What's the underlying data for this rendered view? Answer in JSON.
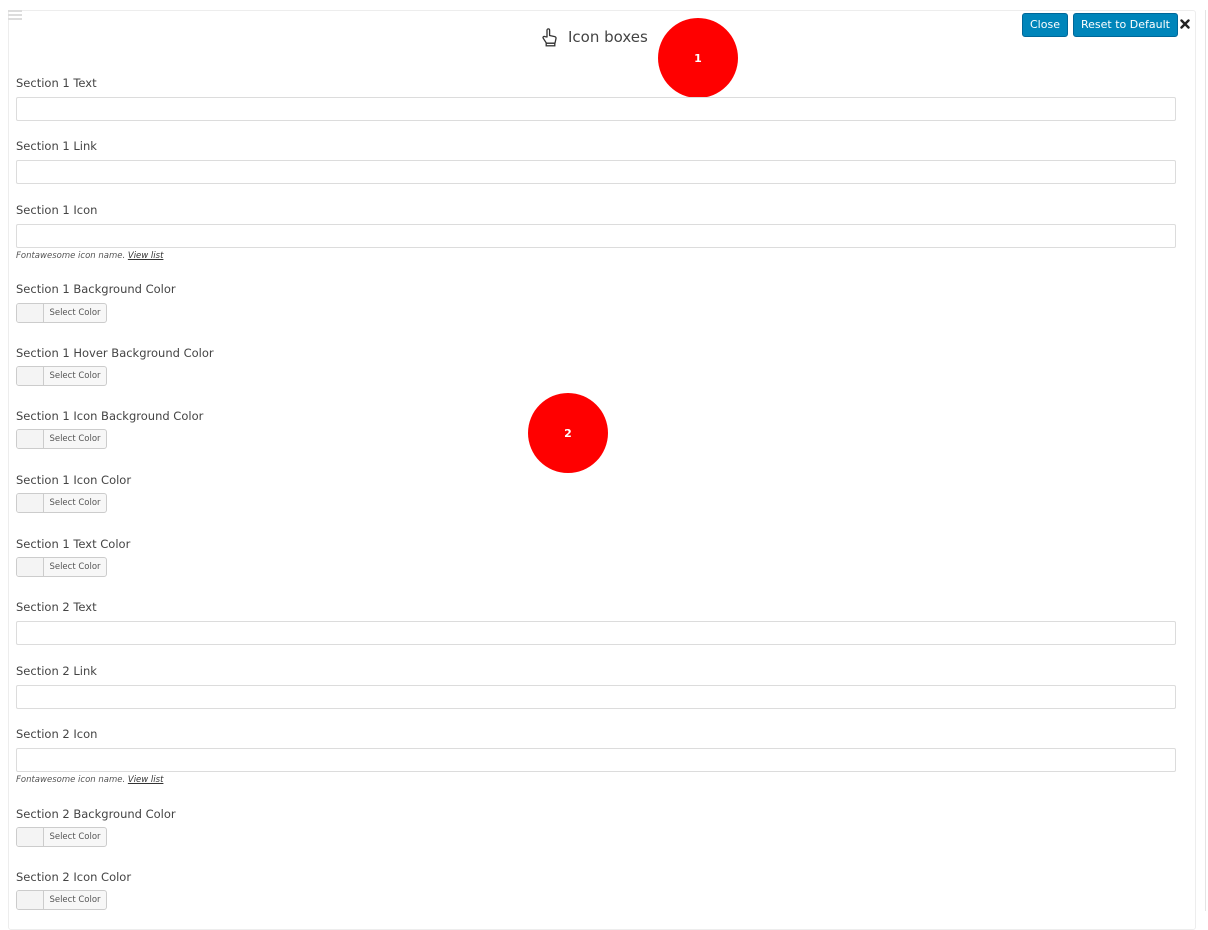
{
  "header": {
    "title": "Icon boxes",
    "close_label": "Close",
    "reset_label": "Reset to Default",
    "title_icon": "hand-pointer-icon",
    "menu_icon": "menu-icon",
    "dismiss_icon": "close-x-icon"
  },
  "callouts": [
    "1",
    "2"
  ],
  "colors": {
    "button": "#0085ba",
    "callout": "#ff0000"
  },
  "helper": {
    "prefix": "Fontawesome icon name. ",
    "link": "View list"
  },
  "select_color_label": "Select Color",
  "fields": [
    {
      "label": "Section 1 Text",
      "type": "text",
      "value": ""
    },
    {
      "label": "Section 1 Link",
      "type": "text",
      "value": ""
    },
    {
      "label": "Section 1 Icon",
      "type": "text",
      "value": ""
    },
    {
      "label": "Section 1 Background Color",
      "type": "color"
    },
    {
      "label": "Section 1 Hover Background Color",
      "type": "color"
    },
    {
      "label": "Section 1 Icon Background Color",
      "type": "color"
    },
    {
      "label": "Section 1 Icon Color",
      "type": "color"
    },
    {
      "label": "Section 1 Text Color",
      "type": "color"
    },
    {
      "label": "Section 2 Text",
      "type": "text",
      "value": ""
    },
    {
      "label": "Section 2 Link",
      "type": "text",
      "value": ""
    },
    {
      "label": "Section 2 Icon",
      "type": "text",
      "value": ""
    },
    {
      "label": "Section 2 Background Color",
      "type": "color"
    },
    {
      "label": "Section 2 Icon Color",
      "type": "color"
    }
  ]
}
